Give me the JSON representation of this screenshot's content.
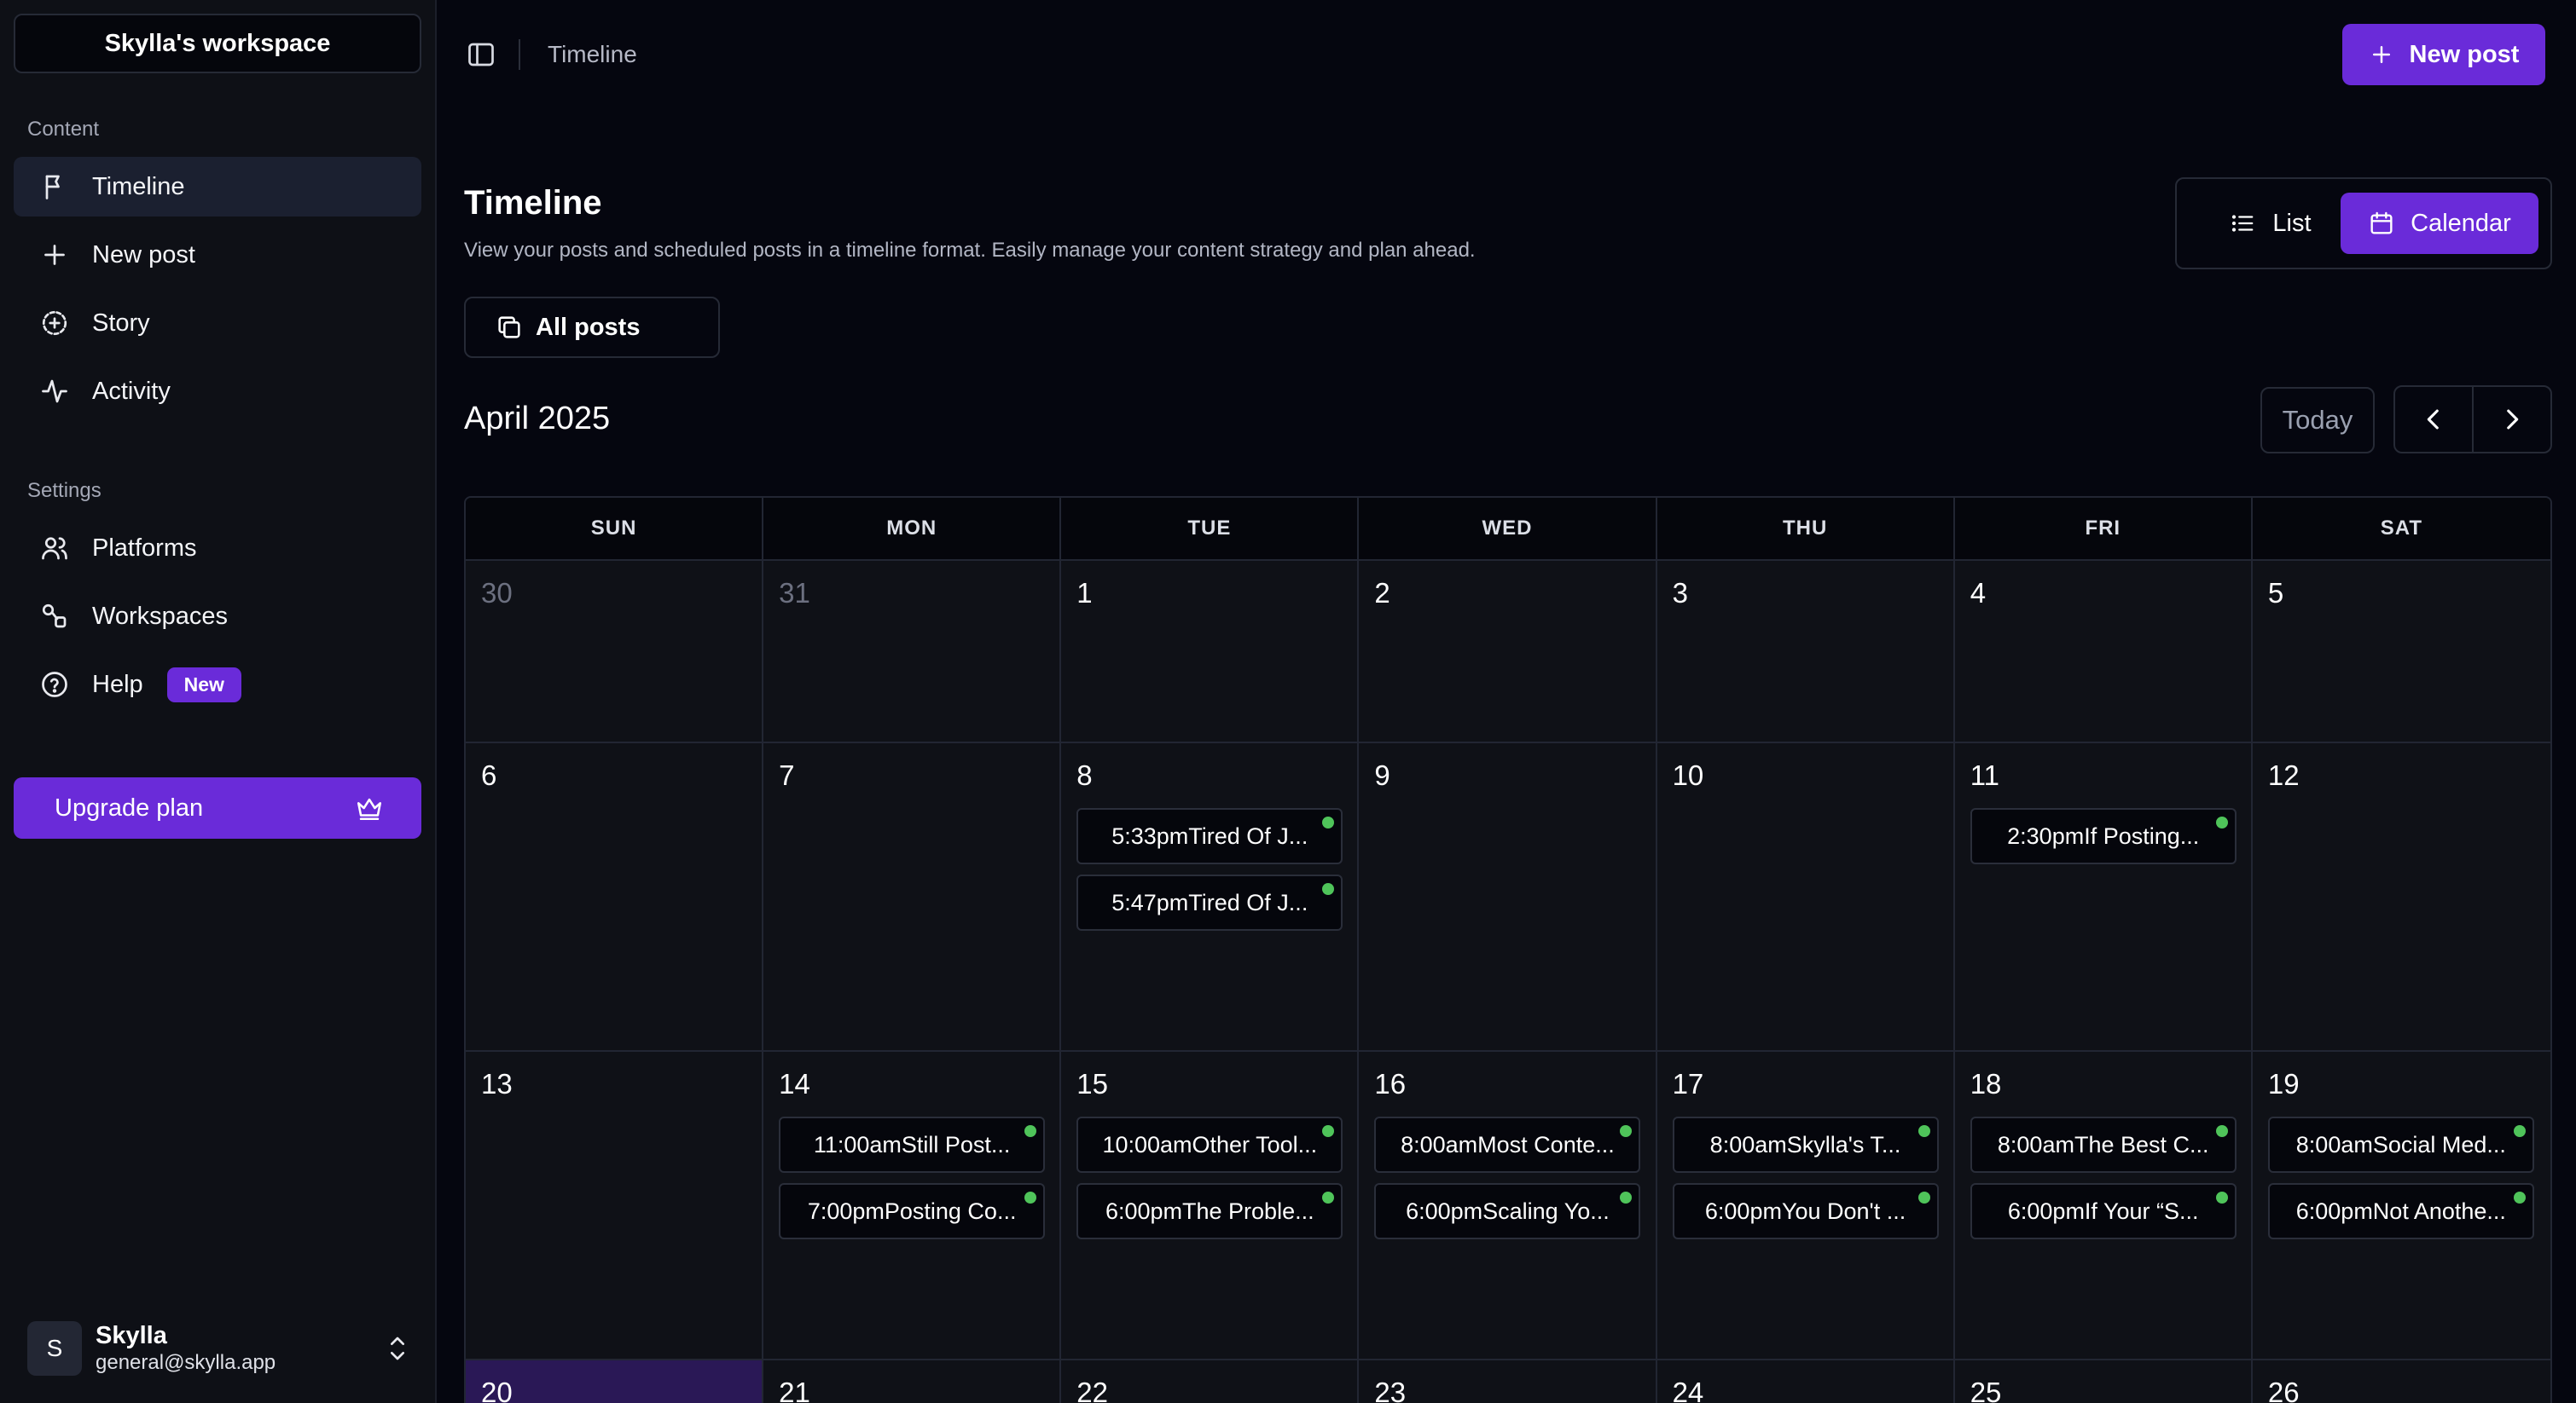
{
  "sidebar": {
    "workspace": "Skylla's workspace",
    "content_label": "Content",
    "settings_label": "Settings",
    "items": {
      "timeline": "Timeline",
      "new_post": "New post",
      "story": "Story",
      "activity": "Activity",
      "platforms": "Platforms",
      "workspaces": "Workspaces",
      "help": "Help"
    },
    "help_badge": "New",
    "upgrade": "Upgrade plan",
    "user": {
      "initial": "S",
      "name": "Skylla",
      "email": "general@skylla.app"
    }
  },
  "topbar": {
    "breadcrumb": "Timeline",
    "new_post": "New post"
  },
  "header": {
    "title": "Timeline",
    "subtitle": "View your posts and scheduled posts in a timeline format. Easily manage your content strategy and plan ahead.",
    "view_list": "List",
    "view_calendar": "Calendar",
    "filter": "All posts"
  },
  "calendar": {
    "month": "April 2025",
    "today_label": "Today",
    "weekdays": [
      "SUN",
      "MON",
      "TUE",
      "WED",
      "THU",
      "FRI",
      "SAT"
    ],
    "days": [
      {
        "n": "30",
        "muted": true
      },
      {
        "n": "31",
        "muted": true
      },
      {
        "n": "1"
      },
      {
        "n": "2"
      },
      {
        "n": "3"
      },
      {
        "n": "4"
      },
      {
        "n": "5"
      },
      {
        "n": "6"
      },
      {
        "n": "7"
      },
      {
        "n": "8",
        "events": [
          "5:33pmTired Of J...",
          "5:47pmTired Of J..."
        ]
      },
      {
        "n": "9"
      },
      {
        "n": "10"
      },
      {
        "n": "11",
        "events": [
          "2:30pmIf Posting..."
        ]
      },
      {
        "n": "12"
      },
      {
        "n": "13"
      },
      {
        "n": "14",
        "events": [
          "11:00amStill Post...",
          "7:00pmPosting Co..."
        ]
      },
      {
        "n": "15",
        "events": [
          "10:00amOther Tool...",
          "6:00pmThe Proble..."
        ]
      },
      {
        "n": "16",
        "events": [
          "8:00amMost Conte...",
          "6:00pmScaling Yo..."
        ]
      },
      {
        "n": "17",
        "events": [
          "8:00amSkylla's T...",
          "6:00pmYou Don't ..."
        ]
      },
      {
        "n": "18",
        "events": [
          "8:00amThe Best C...",
          "6:00pmIf Your “S..."
        ]
      },
      {
        "n": "19",
        "events": [
          "8:00amSocial Med...",
          "6:00pmNot Anothe..."
        ]
      },
      {
        "n": "20",
        "today": true
      },
      {
        "n": "21"
      },
      {
        "n": "22"
      },
      {
        "n": "23"
      },
      {
        "n": "24"
      },
      {
        "n": "25"
      },
      {
        "n": "26"
      }
    ]
  },
  "colors": {
    "accent": "#6a2bd9",
    "status_dot": "#4fc45a",
    "today_cell": "#2a1856"
  }
}
